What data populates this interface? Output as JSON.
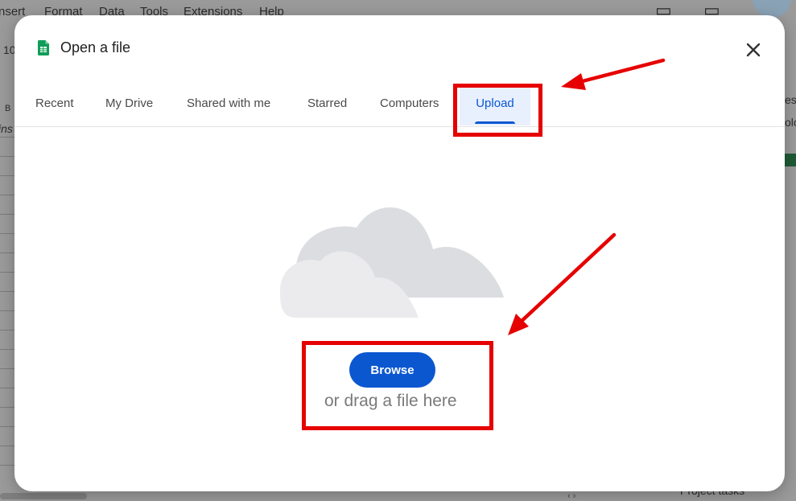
{
  "background": {
    "menu_items": [
      "nsert",
      "Format",
      "Data",
      "Tools",
      "Extensions",
      "Help"
    ],
    "left_fragments": [
      "10",
      "B",
      "ins"
    ],
    "right_fragments": [
      "es",
      "olo"
    ],
    "bottom_text": "Project tasks"
  },
  "dialog": {
    "title": "Open a file",
    "app_icon": "sheets-icon",
    "close_icon": "close-icon",
    "tabs": [
      {
        "label": "Recent"
      },
      {
        "label": "My Drive"
      },
      {
        "label": "Shared with me"
      },
      {
        "label": "Starred"
      },
      {
        "label": "Computers"
      },
      {
        "label": "Upload"
      }
    ],
    "active_tab": "Upload",
    "upload": {
      "illustration": "cloud-illustration",
      "browse_label": "Browse",
      "drag_text": "or drag a file here"
    }
  },
  "colors": {
    "accent": "#0b57d0",
    "active_tab_bg": "#e8f0fe",
    "annotation": "#e60000",
    "sheets_green": "#0f9d58"
  }
}
